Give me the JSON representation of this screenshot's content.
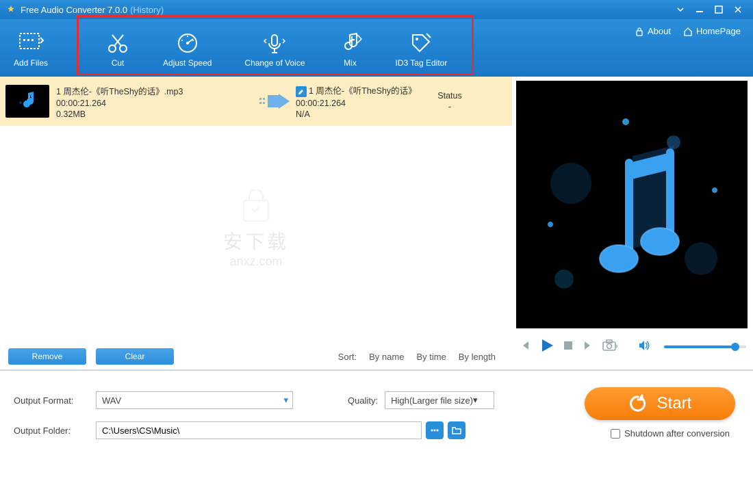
{
  "titlebar": {
    "title": "Free Audio Converter 7.0.0",
    "history": "(History)"
  },
  "toolbar": {
    "add_files": "Add Files",
    "cut": "Cut",
    "adjust_speed": "Adjust Speed",
    "change_voice": "Change of Voice",
    "mix": "Mix",
    "id3": "ID3 Tag Editor",
    "about": "About",
    "homepage": "HomePage"
  },
  "file": {
    "name": "1 周杰伦-《听TheShy的话》.mp3",
    "duration": "00:00:21.264",
    "size": "0.32MB",
    "out_name": "1 周杰伦-《听TheShy的话》",
    "out_duration": "00:00:21.264",
    "out_size": "N/A",
    "status_label": "Status",
    "status_value": "-"
  },
  "list_actions": {
    "remove": "Remove",
    "clear": "Clear",
    "sort": "Sort:",
    "by_name": "By name",
    "by_time": "By time",
    "by_length": "By length"
  },
  "watermark": {
    "line1": "安下载",
    "line2": "anxz.com"
  },
  "output": {
    "format_label": "Output Format:",
    "format_value": "WAV",
    "quality_label": "Quality:",
    "quality_value": "High(Larger file size)",
    "folder_label": "Output Folder:",
    "folder_value": "C:\\Users\\CS\\Music\\"
  },
  "start": "Start",
  "shutdown": "Shutdown after conversion"
}
